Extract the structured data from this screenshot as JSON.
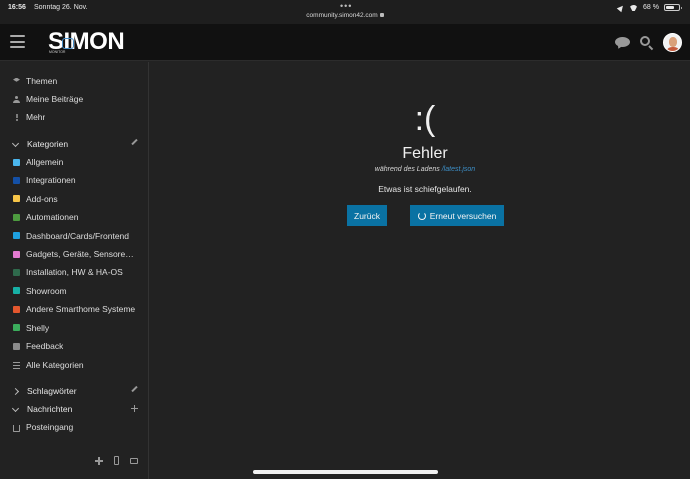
{
  "status_bar": {
    "time": "16:56",
    "date": "Sonntag 26. Nov.",
    "url": "community.simon42.com",
    "battery": "68 %",
    "battery_level": 0.68
  },
  "header": {
    "logo_text": "SIMON",
    "logo_subtext": "MONITOR"
  },
  "sidebar": {
    "top_items": [
      {
        "label": "Themen",
        "icon": "layers-icon"
      },
      {
        "label": "Meine Beiträge",
        "icon": "user-icon"
      },
      {
        "label": "Mehr",
        "icon": "vertical-dots-icon"
      }
    ],
    "categories_header": "Kategorien",
    "categories": [
      {
        "label": "Allgemein",
        "color": "#4ab6ee"
      },
      {
        "label": "Integrationen",
        "color": "#1450a6"
      },
      {
        "label": "Add-ons",
        "color": "#f7c548"
      },
      {
        "label": "Automationen",
        "color": "#4d9b3f"
      },
      {
        "label": "Dashboard/Cards/Frontend",
        "color": "#1ea0df"
      },
      {
        "label": "Gadgets, Geräte, Sensoren & Co.",
        "color": "#e37ad0"
      },
      {
        "label": "Installation, HW & HA-OS",
        "color": "#2f6a4c"
      },
      {
        "label": "Showroom",
        "color": "#17b0a5"
      },
      {
        "label": "Andere Smarthome Systeme",
        "color": "#e4572e"
      },
      {
        "label": "Shelly",
        "color": "#3bad5c"
      },
      {
        "label": "Feedback",
        "color": "#8c8c8c"
      }
    ],
    "all_categories": "Alle Kategorien",
    "tags_header": "Schlagwörter",
    "messages_header": "Nachrichten",
    "inbox": "Posteingang"
  },
  "main": {
    "sad_face": ":(",
    "title": "Fehler",
    "subtitle_prefix": "während des Ladens",
    "subtitle_link": "/latest.json",
    "message": "Etwas ist schiefgelaufen.",
    "back_button": "Zurück",
    "retry_button": "Erneut versuchen"
  }
}
